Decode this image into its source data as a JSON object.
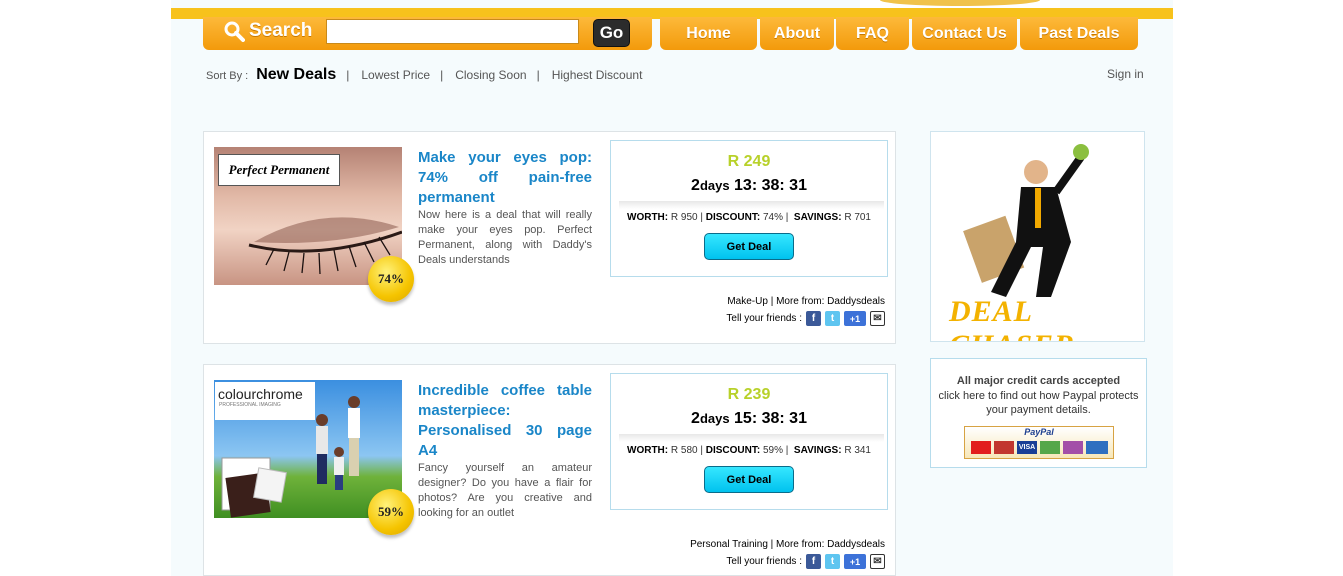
{
  "header": {
    "search_label": "Search",
    "search_value": "",
    "go_label": "Go"
  },
  "nav": [
    {
      "label": "Home"
    },
    {
      "label": "About"
    },
    {
      "label": "FAQ"
    },
    {
      "label": "Contact Us"
    },
    {
      "label": "Past Deals"
    }
  ],
  "sort": {
    "label": "Sort By :",
    "options": [
      "New Deals",
      "Lowest Price",
      "Closing Soon",
      "Highest Discount"
    ],
    "active": "New Deals"
  },
  "signin": "Sign in",
  "deals": [
    {
      "image_text": "Perfect Permanent",
      "badge": "74%",
      "title": "Make your eyes pop: 74% off pain-free permanent",
      "description": "Now here is a deal that will really make your eyes pop. Perfect Permanent, along with Daddy's Deals understands",
      "price": "R 249",
      "timer_days": "2",
      "timer_days_label": "days",
      "timer_clock": "13: 38: 31",
      "worth_label": "WORTH:",
      "worth": "R 950",
      "discount_label": "DISCOUNT:",
      "discount": "74%",
      "savings_label": "SAVINGS:",
      "savings": "R 701",
      "button": "Get Deal",
      "category": "Make-Up | More from: Daddysdeals",
      "tell": "Tell your friends :"
    },
    {
      "image_text": "colourchrome",
      "image_subtext": "PROFESSIONAL IMAGING",
      "badge": "59%",
      "title": "Incredible coffee table masterpiece: Personalised 30 page A4",
      "description": "Fancy yourself an amateur designer? Do you have a flair for photos? Are you creative and looking for an outlet",
      "price": "R 239",
      "timer_days": "2",
      "timer_days_label": "days",
      "timer_clock": "15: 38: 31",
      "worth_label": "WORTH:",
      "worth": "R 580",
      "discount_label": "DISCOUNT:",
      "discount": "59%",
      "savings_label": "SAVINGS:",
      "savings": "R 341",
      "button": "Get Deal",
      "category": "Personal Training | More from: Daddysdeals",
      "tell": "Tell your friends :"
    }
  ],
  "sidebar": {
    "ad_text": "DEAL CHASER",
    "pay_title": "All major credit cards accepted",
    "pay_text": "click here to find out how Paypal protects your payment details.",
    "paypal_label": "PayPal"
  },
  "colors": {
    "accent_orange": "#f7a51c",
    "link_blue": "#1a86c8",
    "price_green": "#b8d12a",
    "button_cyan": "#19d4f7"
  }
}
